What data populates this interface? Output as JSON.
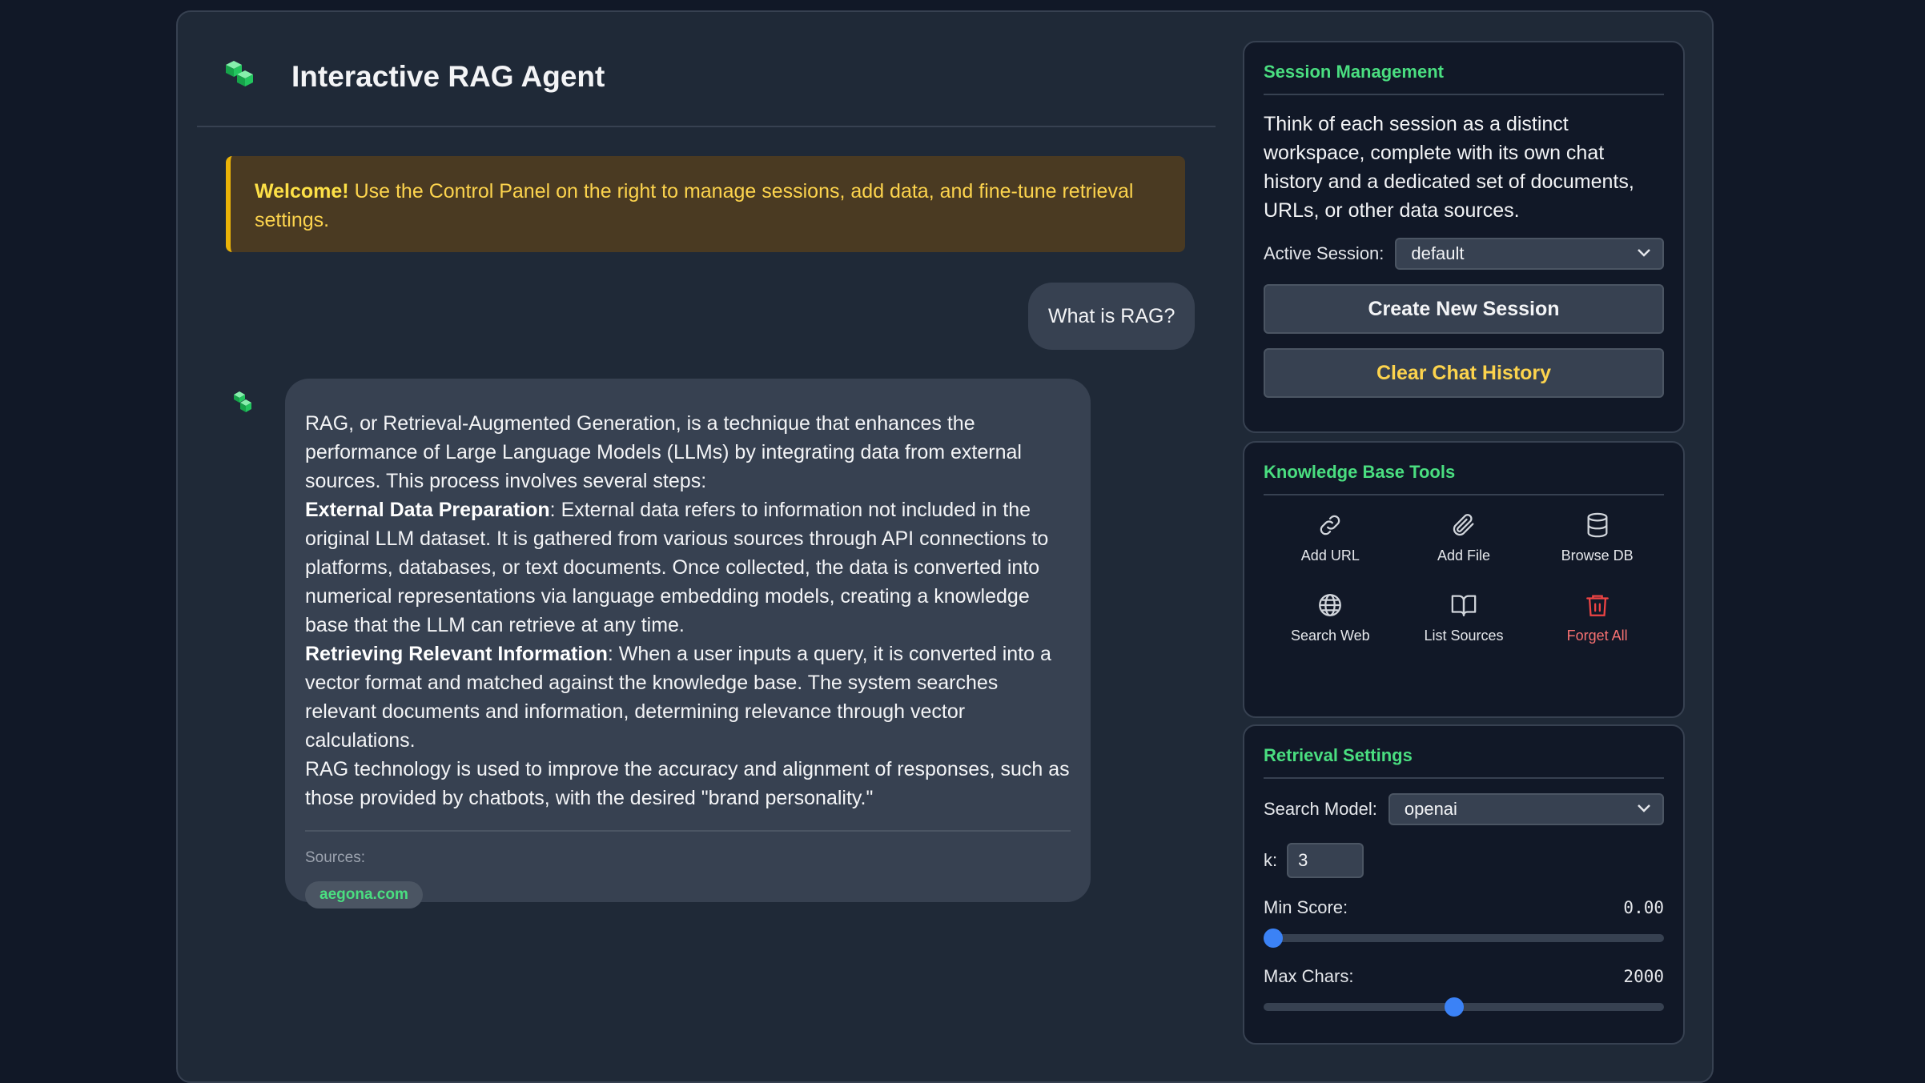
{
  "app": {
    "title": "Interactive RAG Agent"
  },
  "welcome": {
    "bold": "Welcome!",
    "text": " Use the Control Panel on the right to manage sessions, add data, and fine-tune retrieval settings."
  },
  "chat": {
    "user_message": "What is RAG?",
    "bot_intro": "RAG, or Retrieval-Augmented Generation, is a technique that enhances the performance of Large Language Models (LLMs) by integrating data from external sources. This process involves several steps:",
    "bot_point1_title": "External Data Preparation",
    "bot_point1_text": ": External data refers to information not included in the original LLM dataset. It is gathered from various sources through API connections to platforms, databases, or text documents. Once collected, the data is converted into numerical representations via language embedding models, creating a knowledge base that the LLM can retrieve at any time.",
    "bot_point2_title": "Retrieving Relevant Information",
    "bot_point2_text": ": When a user inputs a query, it is converted into a vector format and matched against the knowledge base. The system searches relevant documents and information, determining relevance through vector calculations.",
    "bot_outro": "RAG technology is used to improve the accuracy and alignment of responses, such as those provided by chatbots, with the desired \"brand personality.\"",
    "sources_label": "Sources:",
    "sources": [
      "aegona.com"
    ]
  },
  "session": {
    "title": "Session Management",
    "description": "Think of each session as a distinct workspace, complete with its own chat history and a dedicated set of documents, URLs, or other data sources.",
    "active_label": "Active Session:",
    "active_value": "default",
    "create_label": "Create New Session",
    "clear_label": "Clear Chat History"
  },
  "kb": {
    "title": "Knowledge Base Tools",
    "tools": [
      {
        "label": "Add URL",
        "icon": "link-icon"
      },
      {
        "label": "Add File",
        "icon": "paperclip-icon"
      },
      {
        "label": "Browse DB",
        "icon": "database-icon"
      },
      {
        "label": "Search Web",
        "icon": "globe-icon"
      },
      {
        "label": "List Sources",
        "icon": "book-icon"
      },
      {
        "label": "Forget All",
        "icon": "trash-icon"
      }
    ]
  },
  "retrieval": {
    "title": "Retrieval Settings",
    "model_label": "Search Model:",
    "model_value": "openai",
    "k_label": "k:",
    "k_value": "3",
    "min_score_label": "Min Score:",
    "min_score_value": "0.00",
    "min_score_fraction": 0.0,
    "max_chars_label": "Max Chars:",
    "max_chars_value": "2000",
    "max_chars_fraction": 0.474
  },
  "colors": {
    "accent": "#4ade80",
    "warning": "#fcd34d",
    "danger": "#f87171",
    "slider": "#3b82f6"
  }
}
